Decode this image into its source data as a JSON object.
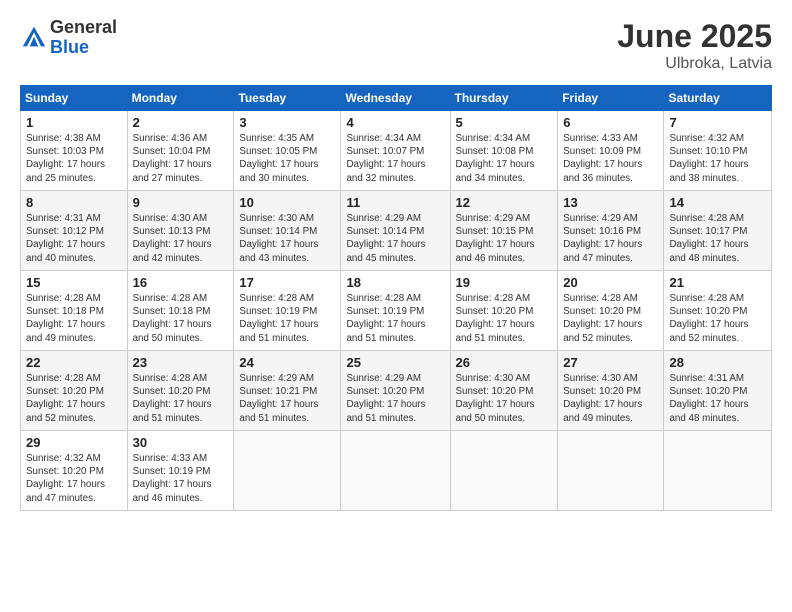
{
  "logo": {
    "general": "General",
    "blue": "Blue"
  },
  "title": "June 2025",
  "location": "Ulbroka, Latvia",
  "headers": [
    "Sunday",
    "Monday",
    "Tuesday",
    "Wednesday",
    "Thursday",
    "Friday",
    "Saturday"
  ],
  "weeks": [
    [
      {
        "day": "1",
        "info": "Sunrise: 4:38 AM\nSunset: 10:03 PM\nDaylight: 17 hours\nand 25 minutes."
      },
      {
        "day": "2",
        "info": "Sunrise: 4:36 AM\nSunset: 10:04 PM\nDaylight: 17 hours\nand 27 minutes."
      },
      {
        "day": "3",
        "info": "Sunrise: 4:35 AM\nSunset: 10:05 PM\nDaylight: 17 hours\nand 30 minutes."
      },
      {
        "day": "4",
        "info": "Sunrise: 4:34 AM\nSunset: 10:07 PM\nDaylight: 17 hours\nand 32 minutes."
      },
      {
        "day": "5",
        "info": "Sunrise: 4:34 AM\nSunset: 10:08 PM\nDaylight: 17 hours\nand 34 minutes."
      },
      {
        "day": "6",
        "info": "Sunrise: 4:33 AM\nSunset: 10:09 PM\nDaylight: 17 hours\nand 36 minutes."
      },
      {
        "day": "7",
        "info": "Sunrise: 4:32 AM\nSunset: 10:10 PM\nDaylight: 17 hours\nand 38 minutes."
      }
    ],
    [
      {
        "day": "8",
        "info": "Sunrise: 4:31 AM\nSunset: 10:12 PM\nDaylight: 17 hours\nand 40 minutes."
      },
      {
        "day": "9",
        "info": "Sunrise: 4:30 AM\nSunset: 10:13 PM\nDaylight: 17 hours\nand 42 minutes."
      },
      {
        "day": "10",
        "info": "Sunrise: 4:30 AM\nSunset: 10:14 PM\nDaylight: 17 hours\nand 43 minutes."
      },
      {
        "day": "11",
        "info": "Sunrise: 4:29 AM\nSunset: 10:14 PM\nDaylight: 17 hours\nand 45 minutes."
      },
      {
        "day": "12",
        "info": "Sunrise: 4:29 AM\nSunset: 10:15 PM\nDaylight: 17 hours\nand 46 minutes."
      },
      {
        "day": "13",
        "info": "Sunrise: 4:29 AM\nSunset: 10:16 PM\nDaylight: 17 hours\nand 47 minutes."
      },
      {
        "day": "14",
        "info": "Sunrise: 4:28 AM\nSunset: 10:17 PM\nDaylight: 17 hours\nand 48 minutes."
      }
    ],
    [
      {
        "day": "15",
        "info": "Sunrise: 4:28 AM\nSunset: 10:18 PM\nDaylight: 17 hours\nand 49 minutes."
      },
      {
        "day": "16",
        "info": "Sunrise: 4:28 AM\nSunset: 10:18 PM\nDaylight: 17 hours\nand 50 minutes."
      },
      {
        "day": "17",
        "info": "Sunrise: 4:28 AM\nSunset: 10:19 PM\nDaylight: 17 hours\nand 51 minutes."
      },
      {
        "day": "18",
        "info": "Sunrise: 4:28 AM\nSunset: 10:19 PM\nDaylight: 17 hours\nand 51 minutes."
      },
      {
        "day": "19",
        "info": "Sunrise: 4:28 AM\nSunset: 10:20 PM\nDaylight: 17 hours\nand 51 minutes."
      },
      {
        "day": "20",
        "info": "Sunrise: 4:28 AM\nSunset: 10:20 PM\nDaylight: 17 hours\nand 52 minutes."
      },
      {
        "day": "21",
        "info": "Sunrise: 4:28 AM\nSunset: 10:20 PM\nDaylight: 17 hours\nand 52 minutes."
      }
    ],
    [
      {
        "day": "22",
        "info": "Sunrise: 4:28 AM\nSunset: 10:20 PM\nDaylight: 17 hours\nand 52 minutes."
      },
      {
        "day": "23",
        "info": "Sunrise: 4:28 AM\nSunset: 10:20 PM\nDaylight: 17 hours\nand 51 minutes."
      },
      {
        "day": "24",
        "info": "Sunrise: 4:29 AM\nSunset: 10:21 PM\nDaylight: 17 hours\nand 51 minutes."
      },
      {
        "day": "25",
        "info": "Sunrise: 4:29 AM\nSunset: 10:20 PM\nDaylight: 17 hours\nand 51 minutes."
      },
      {
        "day": "26",
        "info": "Sunrise: 4:30 AM\nSunset: 10:20 PM\nDaylight: 17 hours\nand 50 minutes."
      },
      {
        "day": "27",
        "info": "Sunrise: 4:30 AM\nSunset: 10:20 PM\nDaylight: 17 hours\nand 49 minutes."
      },
      {
        "day": "28",
        "info": "Sunrise: 4:31 AM\nSunset: 10:20 PM\nDaylight: 17 hours\nand 48 minutes."
      }
    ],
    [
      {
        "day": "29",
        "info": "Sunrise: 4:32 AM\nSunset: 10:20 PM\nDaylight: 17 hours\nand 47 minutes."
      },
      {
        "day": "30",
        "info": "Sunrise: 4:33 AM\nSunset: 10:19 PM\nDaylight: 17 hours\nand 46 minutes."
      },
      {
        "day": "",
        "info": ""
      },
      {
        "day": "",
        "info": ""
      },
      {
        "day": "",
        "info": ""
      },
      {
        "day": "",
        "info": ""
      },
      {
        "day": "",
        "info": ""
      }
    ]
  ]
}
